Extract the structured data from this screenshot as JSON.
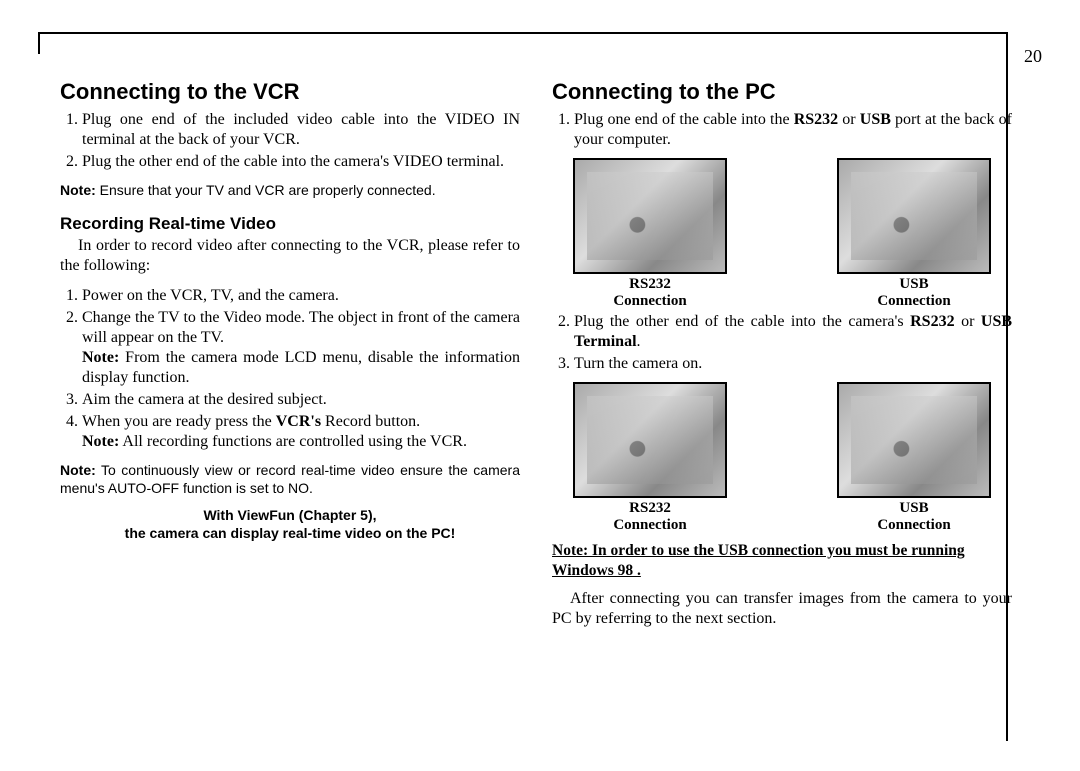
{
  "page_number": "20",
  "left": {
    "h2": "Connecting to the VCR",
    "o1_li1": "Plug one end of the included video cable into the VIDEO IN terminal at the back of your VCR.",
    "o1_li2": "Plug the other end of the cable into the camera's VIDEO terminal.",
    "note1_label": "Note:",
    "note1": "  Ensure that your TV and VCR are properly connected.",
    "h3": "Recording Real-time Video",
    "p1": "In order to record video after connecting to the VCR, please refer to the following:",
    "o2_li1": "Power on the VCR, TV, and the camera.",
    "o2_li2": "Change the TV to the Video mode.  The object in front of the camera will appear on the TV.",
    "o2_li2_note_label": "Note:",
    "o2_li2_note": " From the camera mode LCD menu, disable the information display function.",
    "o2_li3": "Aim the camera at the desired subject.",
    "o2_li4_a": "When you are ready press the ",
    "o2_li4_b": "VCR's",
    "o2_li4_c": " Record button.",
    "o2_li4_note_label": "Note:",
    "o2_li4_note": "  All recording functions are controlled using the VCR.",
    "note2_label": "Note:",
    "note2": " To continuously view or record real-time video ensure the camera menu's AUTO-OFF function is set to NO.",
    "callout_l1": "With ViewFun (Chapter 5),",
    "callout_l2": "the camera can display real-time video on the PC!"
  },
  "right": {
    "h2": "Connecting to the PC",
    "o1_li1_a": "Plug one end of the cable into the ",
    "o1_li1_b": "RS232",
    "o1_li1_c": " or ",
    "o1_li1_d": "USB",
    "o1_li1_e": " port at the back of your computer.",
    "cap_rs232_l1": "RS232",
    "cap_rs232_l2": "Connection",
    "cap_usb_l1": "USB",
    "cap_usb_l2": "Connection",
    "o1_li2_a": "Plug the other end of the cable into the camera's ",
    "o1_li2_b": "RS232",
    "o1_li2_c": " or ",
    "o1_li2_d": "USB Terminal",
    "o1_li2_e": ".",
    "o1_li3": "Turn the camera on.",
    "underline_note": "Note: In order to use the USB connection you must be running Windows 98 .",
    "p_after": "After connecting you can transfer images from the camera to your PC by referring to the next section."
  }
}
